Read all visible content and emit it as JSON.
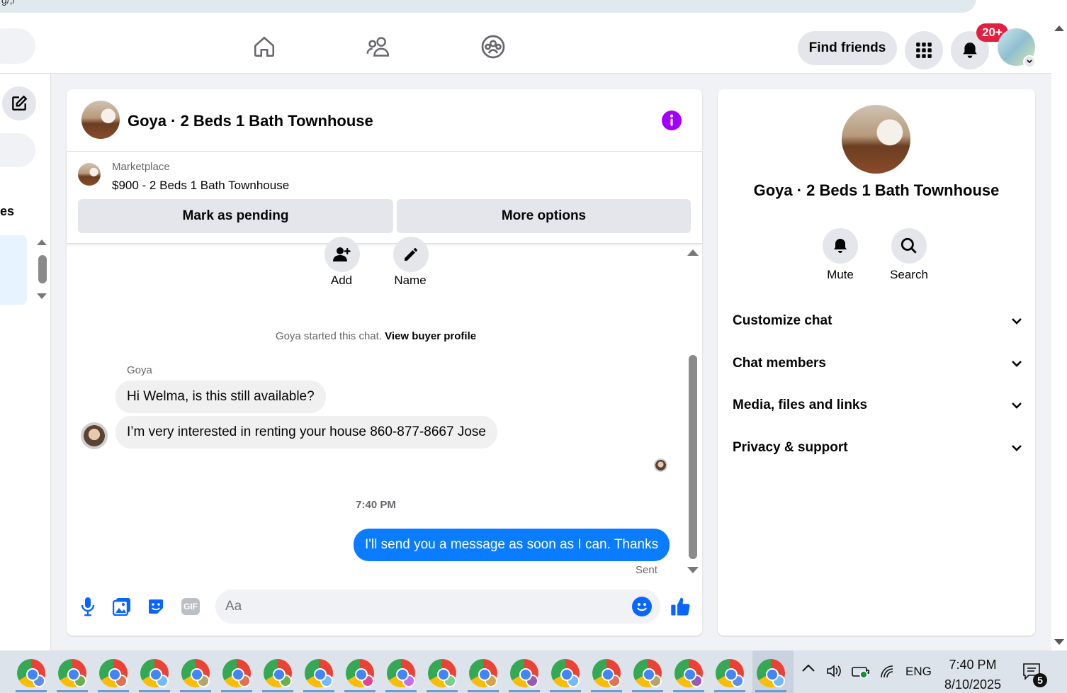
{
  "browser": {
    "url_fragment": "g/,/"
  },
  "topnav": {
    "find_friends": "Find friends",
    "notif_badge": "20+"
  },
  "left": {
    "label_fragment": "es"
  },
  "chat": {
    "title": "Goya · 2 Beds 1 Bath Townhouse",
    "marketplace_label": "Marketplace",
    "listing": "$900 - 2 Beds 1 Bath Townhouse",
    "mark_pending": "Mark as pending",
    "more_options": "More options",
    "add_label": "Add",
    "name_label": "Name",
    "started_text": "Goya started this chat.",
    "view_buyer_profile": "View buyer profile",
    "sender_name": "Goya",
    "messages": [
      {
        "text": "Hi Welma, is this still available?"
      },
      {
        "text": "I’m very interested in renting your house 860-877-8667 Jose"
      }
    ],
    "timestamp": "7:40 PM",
    "my_message": "I'll send you a message as soon as I can. Thanks",
    "status": "Sent",
    "composer_placeholder": "Aa",
    "gif_label": "GIF"
  },
  "details": {
    "title": "Goya · 2 Beds 1 Bath Townhouse",
    "mute": "Mute",
    "search": "Search",
    "sections": [
      "Customize chat",
      "Chat members",
      "Media, files and links",
      "Privacy & support"
    ]
  },
  "taskbar": {
    "lang": "ENG",
    "time": "7:40 PM",
    "date": "8/10/2025",
    "notif_count": "5"
  },
  "colors": {
    "accent": "#0a7cff",
    "info": "#a100ff",
    "badge": "#e41e3f"
  }
}
